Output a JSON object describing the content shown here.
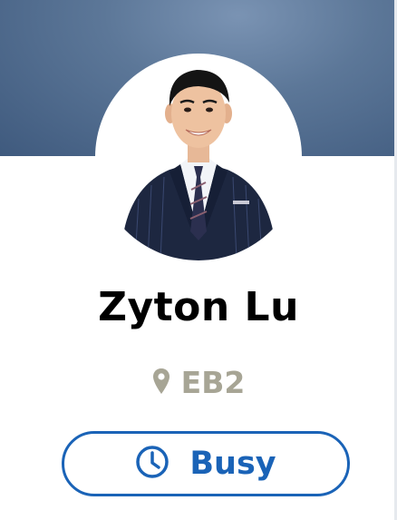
{
  "profile": {
    "name": "Zyton Lu",
    "location": "EB2",
    "status": "Busy"
  },
  "icons": {
    "location": "map-pin-icon",
    "status": "clock-icon"
  },
  "colors": {
    "banner": "#4f6a8e",
    "location_text": "#a7a595",
    "status_accent": "#1a63b7",
    "name_text": "#000000"
  }
}
